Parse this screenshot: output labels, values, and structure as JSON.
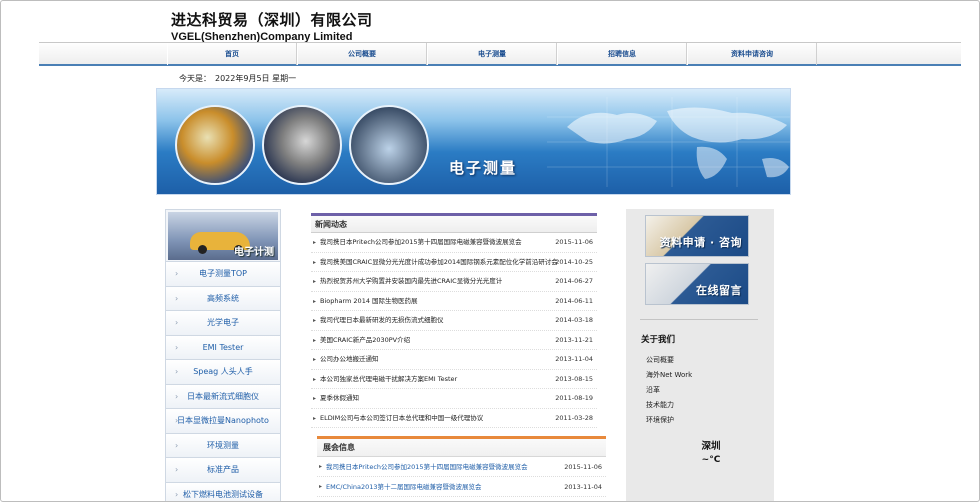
{
  "header": {
    "company_cn": "进达科贸易（深圳）有限公司",
    "company_en": "VGEL(Shenzhen)Company Limited"
  },
  "nav": {
    "items": [
      "首页",
      "公司概要",
      "电子测量",
      "招聘信息",
      "资料申请咨询"
    ]
  },
  "date": {
    "label": "今天是：",
    "value": "2022年9月5日 星期一"
  },
  "banner": {
    "title": "电子测量"
  },
  "sidebar_left": {
    "photo_caption": "电子计测",
    "items": [
      "电子测量TOP",
      "高频系统",
      "光学电子",
      "EMI Tester",
      "Speag 人头人手",
      "日本最新流式细胞仪",
      "日本显微拉曼Nanophoto",
      "环境测量",
      "标准产品",
      "松下燃料电池测试设备"
    ]
  },
  "news": {
    "header": "新闻动态",
    "rows": [
      {
        "title": "我司携日本Pritech公司参加2015第十四届国际电磁兼容暨微波展览会",
        "date": "2015-11-06"
      },
      {
        "title": "我司携美国CRAIC显微分光光度计成功参加2014国际钢系元素配位化学前沿研讨会",
        "date": "2014-10-25"
      },
      {
        "title": "热烈祝贺苏州大学购置并安装国内最先进CRAIC显微分光光度计",
        "date": "2014-06-27"
      },
      {
        "title": "Biopharm 2014 国际生物医药展",
        "date": "2014-06-11"
      },
      {
        "title": "我司代理日本最新研发的无损伤流式细胞仪",
        "date": "2014-03-18"
      },
      {
        "title": "美国CRAIC新产品2030PV介绍",
        "date": "2013-11-21"
      },
      {
        "title": "公司办公地搬迁通知",
        "date": "2013-11-04"
      },
      {
        "title": "本公司独家总代理电磁干扰解决方案EMI Tester",
        "date": "2013-08-15"
      },
      {
        "title": "夏季休假通知",
        "date": "2011-08-19"
      },
      {
        "title": "ELDIM公司与本公司签订日本总代理和中国一级代理协议",
        "date": "2011-03-28"
      }
    ]
  },
  "expo": {
    "header": "展会信息",
    "rows": [
      {
        "title": "我司携日本Pritech公司参加2015第十四届国际电磁兼容暨微波展览会",
        "date": "2015-11-06"
      },
      {
        "title": "EMC/China2013第十二届国际电磁兼容暨微波展览会",
        "date": "2013-11-04"
      }
    ]
  },
  "sidebar_right": {
    "button1_label": "资料申请 · 咨询",
    "button2_label": "在线留言",
    "about_title": "关于我们",
    "about_items": [
      "公司概要",
      "海外Net Work",
      "沿革",
      "技术能力",
      "环境保护"
    ],
    "weather_city": "深圳",
    "weather_temp": "~°C"
  }
}
